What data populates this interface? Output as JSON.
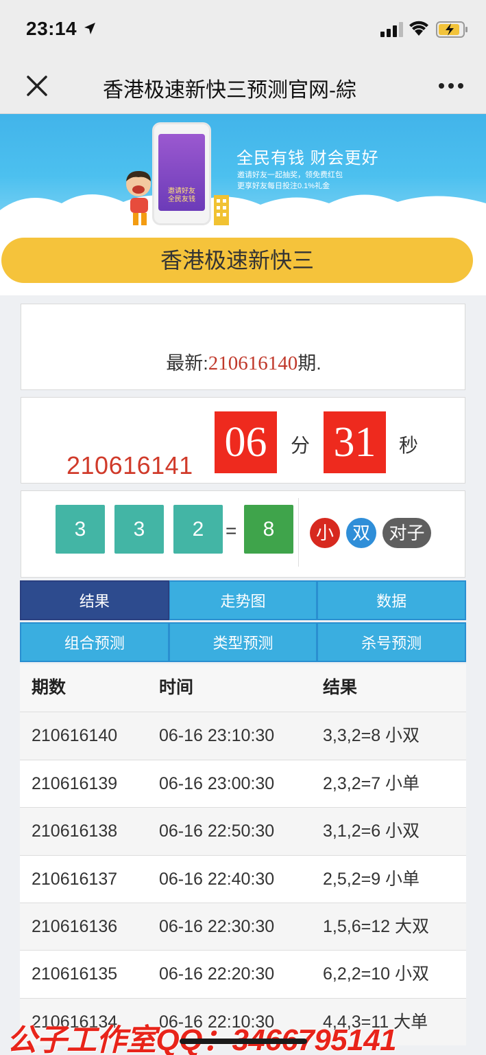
{
  "status_bar": {
    "time": "23:14"
  },
  "nav": {
    "title": "香港极速新快三预测官网-綜"
  },
  "banner": {
    "headline": "全民有钱 财会更好",
    "sub1": "邀请好友一起抽奖，领免费红包",
    "sub2": "更享好友每日投注0.1%礼金",
    "phone_text": "邀请好友 全民友钱"
  },
  "game": {
    "title": "香港极速新快三"
  },
  "latest": {
    "prefix": "最新:",
    "issue": "210616140",
    "suffix": "期."
  },
  "countdown": {
    "next_issue": "210616141",
    "minutes": "06",
    "minutes_unit": "分",
    "seconds": "31",
    "seconds_unit": "秒"
  },
  "result": {
    "dice": [
      "3",
      "3",
      "2"
    ],
    "equals": "=",
    "sum": "8",
    "badges": {
      "size": "小",
      "parity": "双",
      "pair": "对子"
    }
  },
  "tabs": {
    "row1": [
      "结果",
      "走势图",
      "数据"
    ],
    "row2": [
      "组合预测",
      "类型预测",
      "杀号预测"
    ]
  },
  "table": {
    "headers": [
      "期数",
      "时间",
      "结果"
    ],
    "rows": [
      [
        "210616140",
        "06-16 23:10:30",
        "3,3,2=8 小双"
      ],
      [
        "210616139",
        "06-16 23:00:30",
        "2,3,2=7 小单"
      ],
      [
        "210616138",
        "06-16 22:50:30",
        "3,1,2=6 小双"
      ],
      [
        "210616137",
        "06-16 22:40:30",
        "2,5,2=9 小单"
      ],
      [
        "210616136",
        "06-16 22:30:30",
        "1,5,6=12 大双"
      ],
      [
        "210616135",
        "06-16 22:20:30",
        "6,2,2=10 小双"
      ],
      [
        "210616134",
        "06-16 22:10:30",
        "4,4,3=11 大单"
      ]
    ]
  },
  "watermark": "公子工作室QQ：3466795141",
  "colors": {
    "accent_blue": "#3aaee0",
    "active_tab": "#2d4b8e",
    "red": "#ee2a1e",
    "yellow": "#f5c33b",
    "dice": "#43b5a5",
    "sum": "#3fa44b"
  },
  "icons": [
    "location-arrow-icon",
    "signal-icon",
    "wifi-icon",
    "battery-charging-icon",
    "close-icon",
    "more-icon"
  ]
}
